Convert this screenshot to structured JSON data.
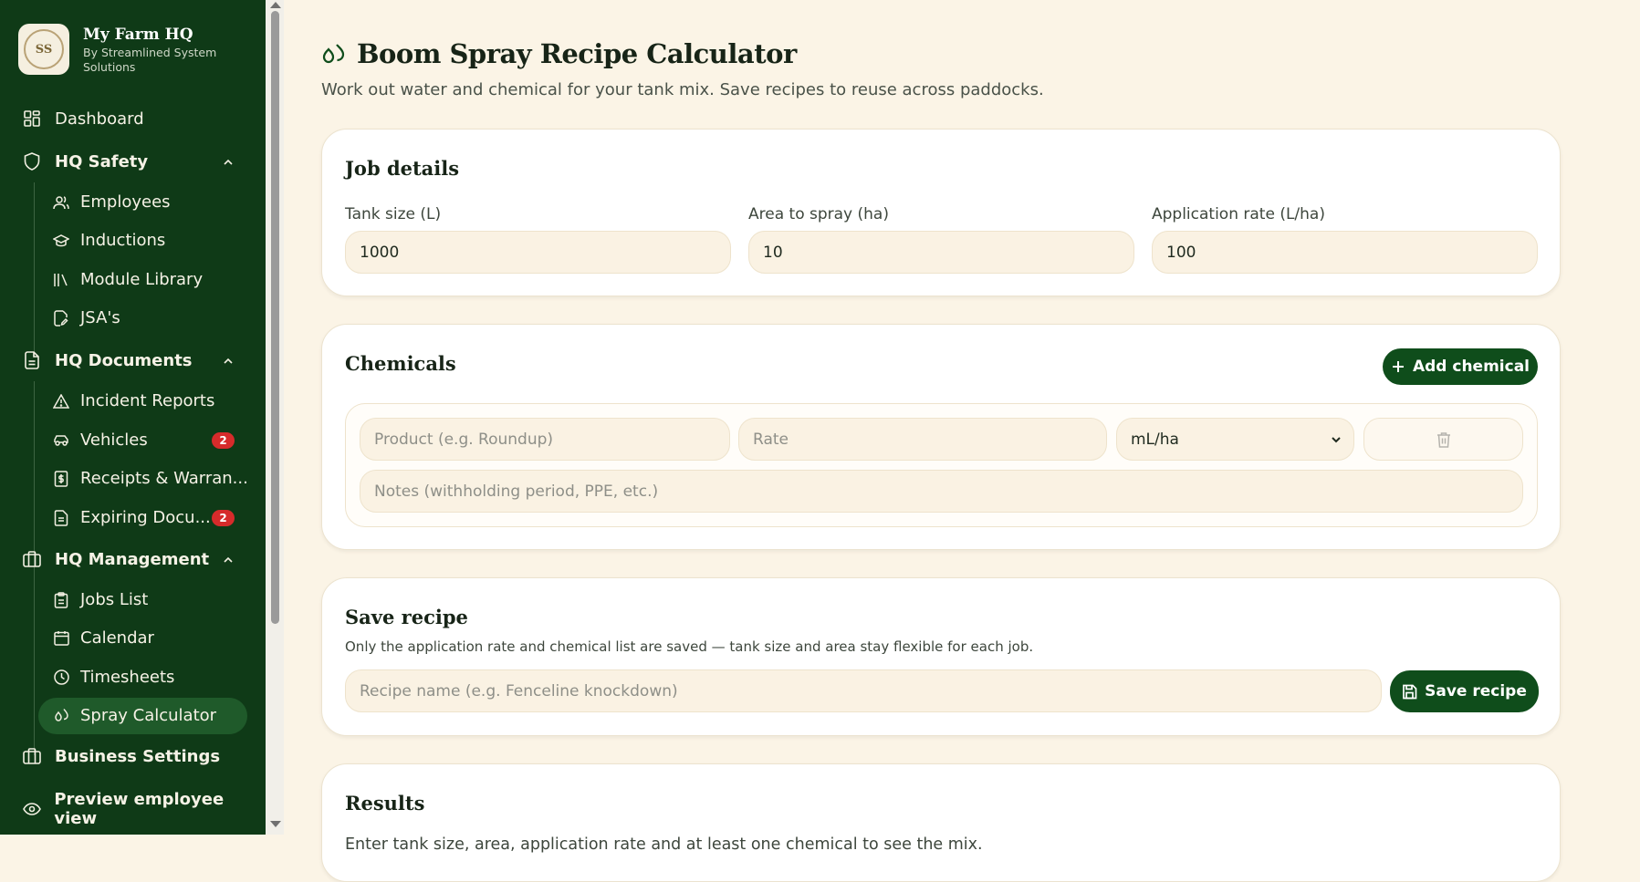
{
  "brand": {
    "title": "My Farm HQ",
    "subtitle": "By Streamlined System Solutions",
    "logo_text": "SS"
  },
  "sidebar": {
    "dashboard": "Dashboard",
    "hq_safety": "HQ Safety",
    "safety_items": [
      "Employees",
      "Inductions",
      "Module Library",
      "JSA's"
    ],
    "hq_documents": "HQ Documents",
    "document_items": [
      "Incident Reports",
      "Vehicles",
      "Receipts & Warran...",
      "Expiring Docu..."
    ],
    "vehicles_badge": "2",
    "expiring_badge": "2",
    "hq_management": "HQ Management",
    "management_items": [
      "Jobs List",
      "Calendar",
      "Timesheets",
      "Spray Calculator"
    ],
    "business_settings": "Business Settings",
    "preview": "Preview employee view"
  },
  "page": {
    "title": "Boom Spray Recipe Calculator",
    "subtitle": "Work out water and chemical for your tank mix. Save recipes to reuse across paddocks."
  },
  "job": {
    "title": "Job details",
    "tank_label": "Tank size (L)",
    "tank_value": "1000",
    "area_label": "Area to spray (ha)",
    "area_value": "10",
    "rate_label": "Application rate (L/ha)",
    "rate_value": "100"
  },
  "chemicals": {
    "title": "Chemicals",
    "add_label": "Add chemical",
    "product_placeholder": "Product (e.g. Roundup)",
    "rate_placeholder": "Rate",
    "unit_selected": "mL/ha",
    "notes_placeholder": "Notes (withholding period, PPE, etc.)"
  },
  "recipe": {
    "title": "Save recipe",
    "note": "Only the application rate and chemical list are saved — tank size and area stay flexible for each job.",
    "name_placeholder": "Recipe name (e.g. Fenceline knockdown)",
    "save_label": "Save recipe"
  },
  "results": {
    "title": "Results",
    "empty_text": "Enter tank size, area, application rate and at least one chemical to see the mix."
  },
  "colors": {
    "sidebar_bg": "#0f3a17",
    "accent": "#0f4d1b",
    "page_bg": "#fbf4e6",
    "badge": "#d62b2b"
  }
}
